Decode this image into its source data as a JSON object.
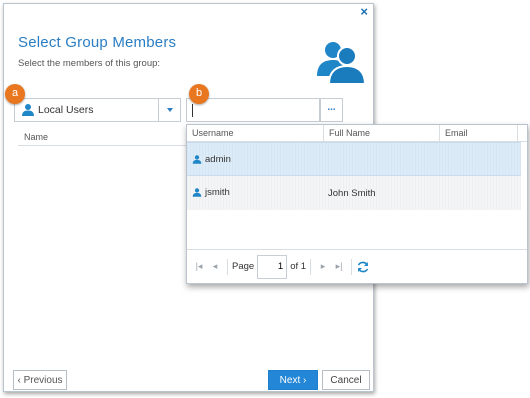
{
  "dialog": {
    "close_glyph": "×",
    "title": "Select Group Members",
    "subtitle": "Select the members of this group:"
  },
  "badges": {
    "a": "a",
    "b": "b"
  },
  "source_select": {
    "selected": "Local Users"
  },
  "search": {
    "value": "",
    "more_label": "..."
  },
  "members_grid": {
    "header_name": "Name"
  },
  "results": {
    "columns": [
      "Username",
      "Full Name",
      "Email"
    ],
    "rows": [
      {
        "username": "admin",
        "full_name": "",
        "email": ""
      },
      {
        "username": "jsmith",
        "full_name": "John Smith",
        "email": ""
      }
    ],
    "pager": {
      "page_label": "Page",
      "page_value": "1",
      "of_label": "of 1"
    }
  },
  "footer": {
    "previous": "‹ Previous",
    "next": "Next ›",
    "cancel": "Cancel"
  },
  "colors": {
    "accent": "#2a7dc3",
    "badge": "#e8771f",
    "primary_button": "#2486d6"
  },
  "icons": [
    "close-icon",
    "users-group-icon",
    "user-icon",
    "chevron-down-icon",
    "first-page-icon",
    "prev-page-icon",
    "next-page-icon",
    "last-page-icon",
    "refresh-icon"
  ]
}
